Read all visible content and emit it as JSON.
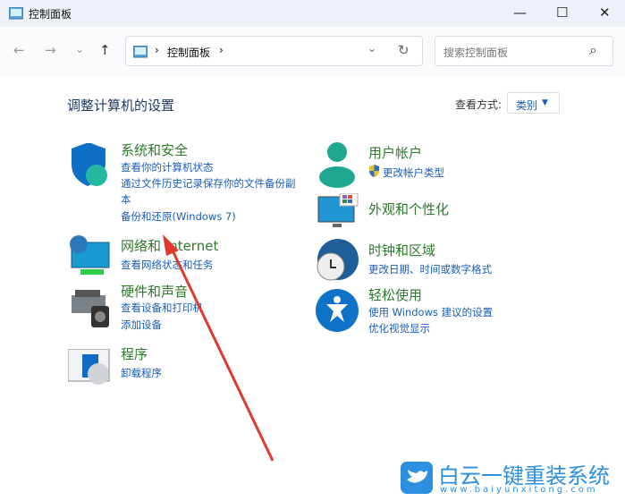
{
  "window": {
    "title": "控制面板",
    "minimize": "—",
    "maximize": "☐",
    "close": "✕"
  },
  "nav": {
    "back": "←",
    "forward": "→",
    "recent": "⌄",
    "up": "↑"
  },
  "address": {
    "crumbs": [
      "控制面板"
    ],
    "sep": "›",
    "dropdown": "⌄",
    "refresh": "↻"
  },
  "search": {
    "placeholder": "搜索控制面板",
    "icon": "⌕"
  },
  "heading": "调整计算机的设置",
  "view": {
    "label": "查看方式:",
    "value": "类别",
    "caret": "▼"
  },
  "left": [
    {
      "title": "系统和安全",
      "icon": "shield-icon",
      "links": [
        "查看你的计算机状态",
        "通过文件历史记录保存你的文件备份副",
        "本",
        "备份和还原(Windows 7)"
      ]
    },
    {
      "title": "网络和 Internet",
      "icon": "network-icon",
      "links": [
        "查看网络状态和任务"
      ]
    },
    {
      "title": "硬件和声音",
      "icon": "printer-icon",
      "links": [
        "查看设备和打印机",
        "添加设备"
      ]
    },
    {
      "title": "程序",
      "icon": "programs-icon",
      "links": [
        "卸载程序"
      ]
    }
  ],
  "right": [
    {
      "title": "用户帐户",
      "icon": "user-icon",
      "links": [
        "更改帐户类型"
      ]
    },
    {
      "title": "外观和个性化",
      "icon": "monitor-icon",
      "links": []
    },
    {
      "title": "时钟和区域",
      "icon": "clock-globe-icon",
      "links": [
        "更改日期、时间或数字格式"
      ]
    },
    {
      "title": "轻松使用",
      "icon": "accessibility-icon",
      "links": [
        "使用 Windows 建议的设置",
        "优化视觉显示"
      ]
    }
  ],
  "watermark": {
    "name": "白云一键重装系统",
    "url": "www.baiyunxitong.com"
  },
  "colors": {
    "category": "#2c7a2a",
    "link": "#1a5db8",
    "arrow": "#e03a2f"
  }
}
